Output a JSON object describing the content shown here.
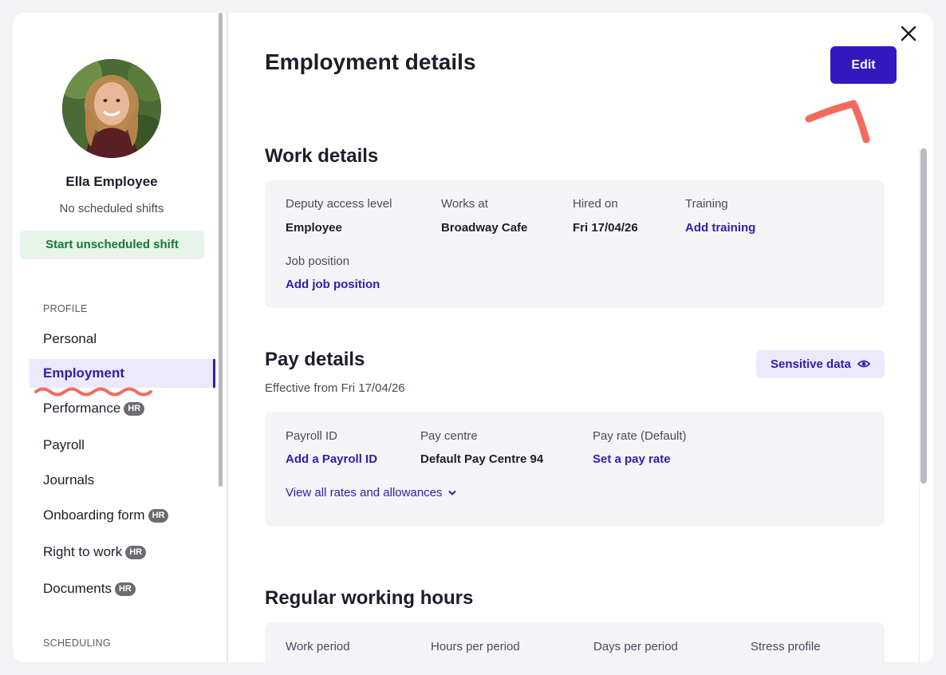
{
  "sidebar": {
    "employee_name": "Ella Employee",
    "schedule_status": "No scheduled shifts",
    "start_shift_label": "Start unscheduled shift",
    "profile_section": "PROFILE",
    "scheduling_section": "SCHEDULING",
    "hr_badge": "HR",
    "items": [
      {
        "label": "Personal",
        "hr": false,
        "active": false
      },
      {
        "label": "Employment",
        "hr": false,
        "active": true
      },
      {
        "label": "Performance",
        "hr": true,
        "active": false
      },
      {
        "label": "Payroll",
        "hr": false,
        "active": false
      },
      {
        "label": "Journals",
        "hr": false,
        "active": false
      },
      {
        "label": "Onboarding form",
        "hr": true,
        "active": false
      },
      {
        "label": "Right to work",
        "hr": true,
        "active": false
      },
      {
        "label": "Documents",
        "hr": true,
        "active": false
      }
    ]
  },
  "main": {
    "title": "Employment details",
    "edit_label": "Edit",
    "work_details": {
      "heading": "Work details",
      "fields": [
        {
          "label": "Deputy access level",
          "value": "Employee",
          "link": false
        },
        {
          "label": "Works at",
          "value": "Broadway Cafe",
          "link": false
        },
        {
          "label": "Hired on",
          "value": "Fri 17/04/26",
          "link": false
        },
        {
          "label": "Training",
          "value": "Add training",
          "link": true
        },
        {
          "label": "Job position",
          "value": "Add job position",
          "link": true
        }
      ]
    },
    "pay_details": {
      "heading": "Pay details",
      "effective": "Effective from Fri 17/04/26",
      "sensitive_label": "Sensitive data",
      "fields": [
        {
          "label": "Payroll ID",
          "value": "Add a Payroll ID",
          "link": true
        },
        {
          "label": "Pay centre",
          "value": "Default Pay Centre 94",
          "link": false
        },
        {
          "label": "Pay rate (Default)",
          "value": "Set a pay rate",
          "link": true
        }
      ],
      "view_all": "View all rates and allowances"
    },
    "working_hours": {
      "heading": "Regular working hours",
      "columns": [
        "Work period",
        "Hours per period",
        "Days per period",
        "Stress profile"
      ]
    }
  },
  "colors": {
    "accent": "#3319bd",
    "active_bg": "#ece9fb",
    "start_bg": "#e6f4ea",
    "start_text": "#177a2c",
    "annotation": "#f26b5e"
  }
}
